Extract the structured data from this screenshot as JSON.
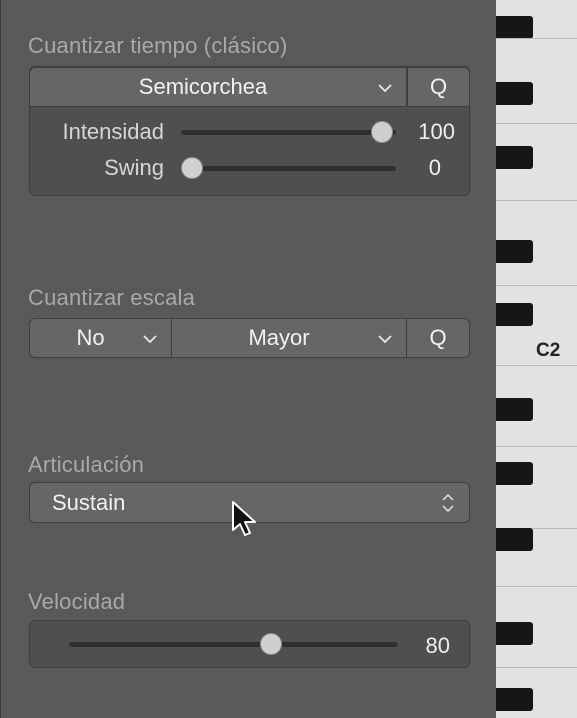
{
  "quantize_time": {
    "title": "Cuantizar tiempo (clásico)",
    "value": "Semicorchea",
    "q_label": "Q",
    "strength_label": "Intensidad",
    "strength_value": "100",
    "strength_level": 1.0,
    "swing_label": "Swing",
    "swing_value": "0",
    "swing_level": 0.0
  },
  "quantize_scale": {
    "title": "Cuantizar escala",
    "root_value": "No",
    "scale_value": "Mayor",
    "q_label": "Q"
  },
  "articulation": {
    "title": "Articulación",
    "value": "Sustain"
  },
  "velocity": {
    "title": "Velocidad",
    "value": "80",
    "level": 0.63
  },
  "keyboard": {
    "c_label": "C2"
  },
  "icons": [
    "chevron-down-icon",
    "updown-chevron-icon",
    "mouse-pointer-icon"
  ]
}
